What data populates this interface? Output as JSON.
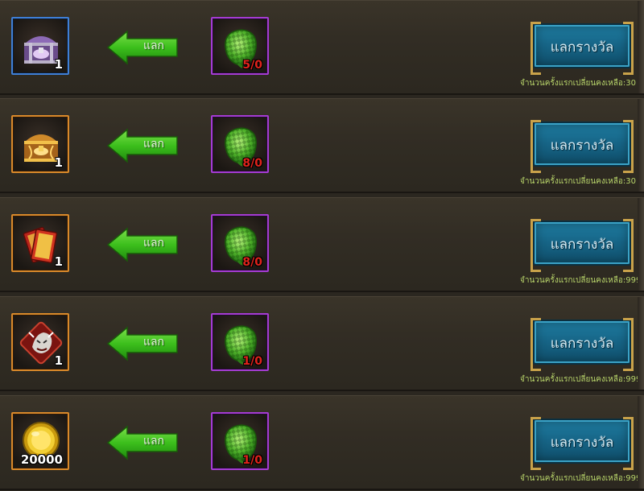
{
  "colors": {
    "accent_green": "#3cc21a",
    "claim_blue": "#176688",
    "remaining_text": "#b8d46a"
  },
  "rows": [
    {
      "reward": {
        "icon": "silver-chest-icon",
        "rarity": "blue",
        "qty": "1"
      },
      "exchange_label": "แลก",
      "cost": {
        "icon": "woven-ketupat-icon",
        "rarity": "purple",
        "count": "5/0"
      },
      "claim_label": "แลกรางวัล",
      "remaining": "จำนวนครั้งแรกเปลี่ยนคงเหลือ:30"
    },
    {
      "reward": {
        "icon": "golden-chest-icon",
        "rarity": "orange",
        "qty": "1"
      },
      "exchange_label": "แลก",
      "cost": {
        "icon": "woven-ketupat-icon",
        "rarity": "purple",
        "count": "8/0"
      },
      "claim_label": "แลกรางวัล",
      "remaining": "จำนวนครั้งแรกเปลี่ยนคงเหลือ:30"
    },
    {
      "reward": {
        "icon": "red-card-pack-icon",
        "rarity": "orange",
        "qty": "1"
      },
      "exchange_label": "แลก",
      "cost": {
        "icon": "woven-ketupat-icon",
        "rarity": "purple",
        "count": "8/0"
      },
      "claim_label": "แลกรางวัล",
      "remaining": "จำนวนครั้งแรกเปลี่ยนคงเหลือ:999"
    },
    {
      "reward": {
        "icon": "beast-emblem-icon",
        "rarity": "orange",
        "qty": "1"
      },
      "exchange_label": "แลก",
      "cost": {
        "icon": "woven-ketupat-icon",
        "rarity": "purple",
        "count": "1/0"
      },
      "claim_label": "แลกรางวัล",
      "remaining": "จำนวนครั้งแรกเปลี่ยนคงเหลือ:999"
    },
    {
      "reward": {
        "icon": "gold-coin-icon",
        "rarity": "orange",
        "qty": "20000"
      },
      "exchange_label": "แลก",
      "cost": {
        "icon": "woven-ketupat-icon",
        "rarity": "purple",
        "count": "1/0"
      },
      "claim_label": "แลกรางวัล",
      "remaining": "จำนวนครั้งแรกเปลี่ยนคงเหลือ:999"
    }
  ]
}
